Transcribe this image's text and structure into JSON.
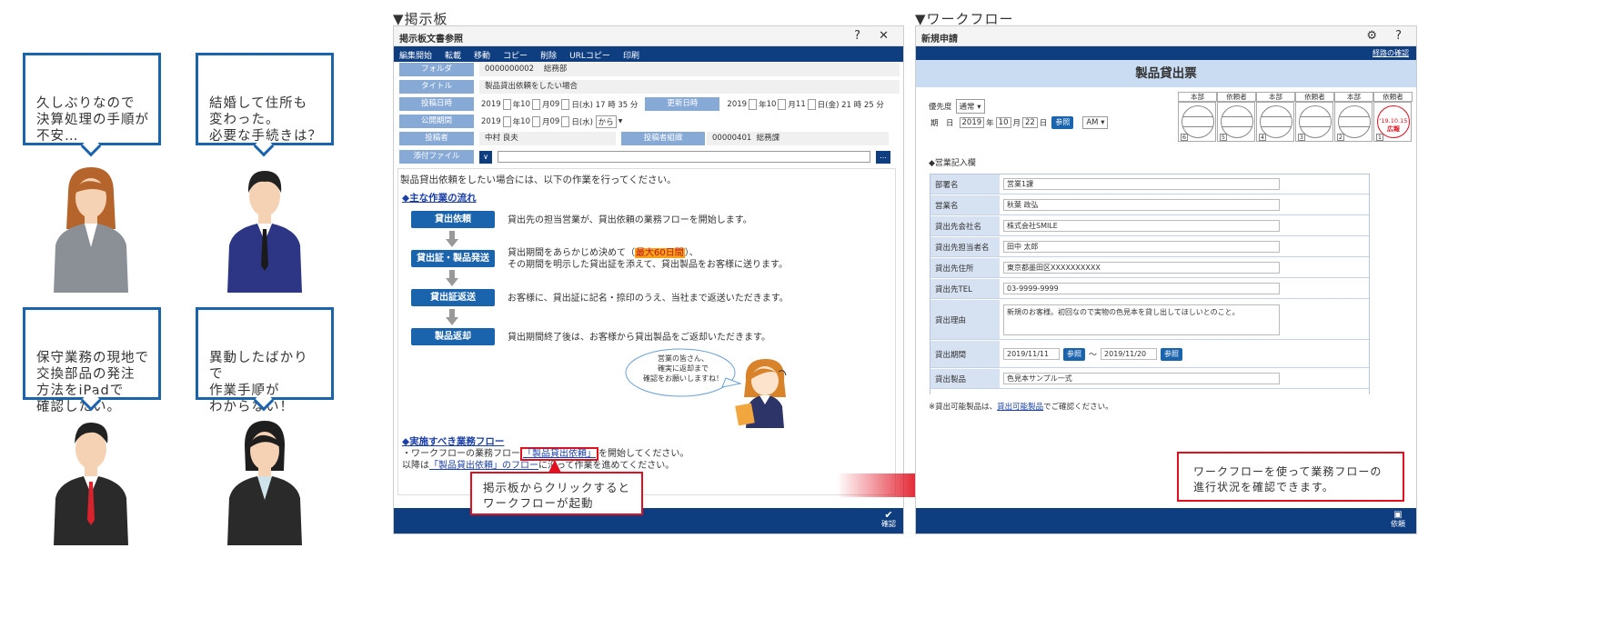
{
  "personas": [
    {
      "text": "久しぶりなので\n決算処理の手順が\n不安…"
    },
    {
      "text": "結婚して住所も\n変わった。\n必要な手続きは？"
    },
    {
      "text": "保守業務の現地で\n交換部品の発注\n方法をiPadで\n確認したい。"
    },
    {
      "text": "異動したばかりで\n作業手順が\nわからない！"
    }
  ],
  "bulletin": {
    "section_label": "▼掲示板",
    "window_title": "掲示板文書参照",
    "window_controls": "? ✕",
    "menu": [
      "編集開始",
      "転載",
      "移動",
      "コピー",
      "削除",
      "URLコピー",
      "印刷"
    ],
    "fields": {
      "folder_label": "フォルダ",
      "folder_code": "0000000002",
      "folder_name": "総務部",
      "title_label": "タイトル",
      "title_value": "製品貸出依頼をしたい場合",
      "posted_label": "投稿日時",
      "posted_year": "2019",
      "posted_month": "10",
      "posted_day": "09",
      "posted_dow": "日(水)",
      "posted_time": "17 時 35 分",
      "updated_label": "更新日時",
      "updated_year": "2019",
      "updated_month": "10",
      "updated_day": "11",
      "updated_dow": "日(金)",
      "updated_time": "21 時 25 分",
      "publish_label": "公開期間",
      "publish_year": "2019",
      "publish_month": "10",
      "publish_day": "09",
      "publish_dow": "日(水)",
      "publish_from": "から",
      "author_label": "投稿者",
      "author_name": "中村 良夫",
      "author_group_label": "投稿者組織",
      "author_group_code": "00000401",
      "author_group_name": "総務課",
      "attach_label": "添付ファイル",
      "unit_year": "年",
      "unit_month": "月"
    },
    "intro": "製品貸出依頼をしたい場合には、以下の作業を行ってください。",
    "flow_heading": "◆主な作業の流れ",
    "steps": [
      {
        "label": "貸出依頼",
        "text": "貸出先の担当営業が、貸出依頼の業務フローを開始します。"
      },
      {
        "label": "貸出証・製品発送",
        "text_before": "貸出期間をあらかじめ決めて（",
        "highlight": "最大60日間",
        "text_after": "）、\nその期間を明示した貸出証を添えて、貸出製品をお客様に送ります。"
      },
      {
        "label": "貸出証返送",
        "text": "お客様に、貸出証に記名・捺印のうえ、当社まで返送いただきます。"
      },
      {
        "label": "製品返却",
        "text": "貸出期間終了後は、お客様から貸出製品をご返却いただきます。"
      }
    ],
    "speech": "営業の皆さん、\n確実に返却まで\n確認をお願いしますね！",
    "must_heading": "◆実施すべき業務フロー",
    "must_line1_before": "・ワークフローの業務フロー",
    "must_line1_link": "「製品貸出依頼」",
    "must_line1_after": "を開始してください。",
    "must_line2_before": "以降は",
    "must_line2_link": "「製品貸出依頼」のフロー",
    "must_line2_after": "に沿って作業を進めてください。",
    "callout": "掲示板からクリックすると\nワークフローが起動",
    "confirm_label": "確認",
    "accent": "#0f3e80",
    "highlight_color": "#f7a21b"
  },
  "workflow": {
    "section_label": "▼ワークフロー",
    "window_title": "新規申請",
    "window_controls": "⚙ ?",
    "route_link": "経路の確認",
    "form_title": "製品貸出票",
    "priority_label": "優先度",
    "priority_value": "通常",
    "date_label": "期　日",
    "date_year": "2019",
    "date_month": "10",
    "date_day": "22",
    "date_unit_year": "年",
    "date_unit_month": "月",
    "date_unit_day": "日",
    "ref_label": "参照",
    "ampm": "AM",
    "stamp_headers": [
      "本部",
      "依頼者",
      "本部",
      "依頼者",
      "本部",
      "依頼者"
    ],
    "stamp_numbers": [
      "6",
      "5",
      "4",
      "3",
      "2",
      "1"
    ],
    "stamp_date": "'19.10.15",
    "stamp_name": "広報",
    "sales_heading": "◆営業記入欄",
    "rows": [
      {
        "label": "部署名",
        "value": "営業1課"
      },
      {
        "label": "営業名",
        "value": "秋葉 政弘"
      },
      {
        "label": "貸出先会社名",
        "value": "株式会社SMILE"
      },
      {
        "label": "貸出先担当者名",
        "value": "田中 太郎"
      },
      {
        "label": "貸出先住所",
        "value": "東京都墨田区XXXXXXXXXX"
      },
      {
        "label": "貸出先TEL",
        "value": "03-9999-9999"
      },
      {
        "label": "貸出理由",
        "value": "新規のお客様。初回なので実物の色見本を貸し出してほしいとのこと。"
      },
      {
        "label": "貸出期間",
        "from": "2019/11/11",
        "to": "2019/11/20",
        "sep": "〜"
      },
      {
        "label": "貸出製品",
        "value": "色見本サンプル一式"
      }
    ],
    "note_before": "※貸出可能製品は、",
    "note_link": "貸出可能製品",
    "note_after": "でご確認ください。",
    "callout": "ワークフローを使って業務フローの\n進行状況を確認できます。",
    "submit_label": "依頼"
  }
}
